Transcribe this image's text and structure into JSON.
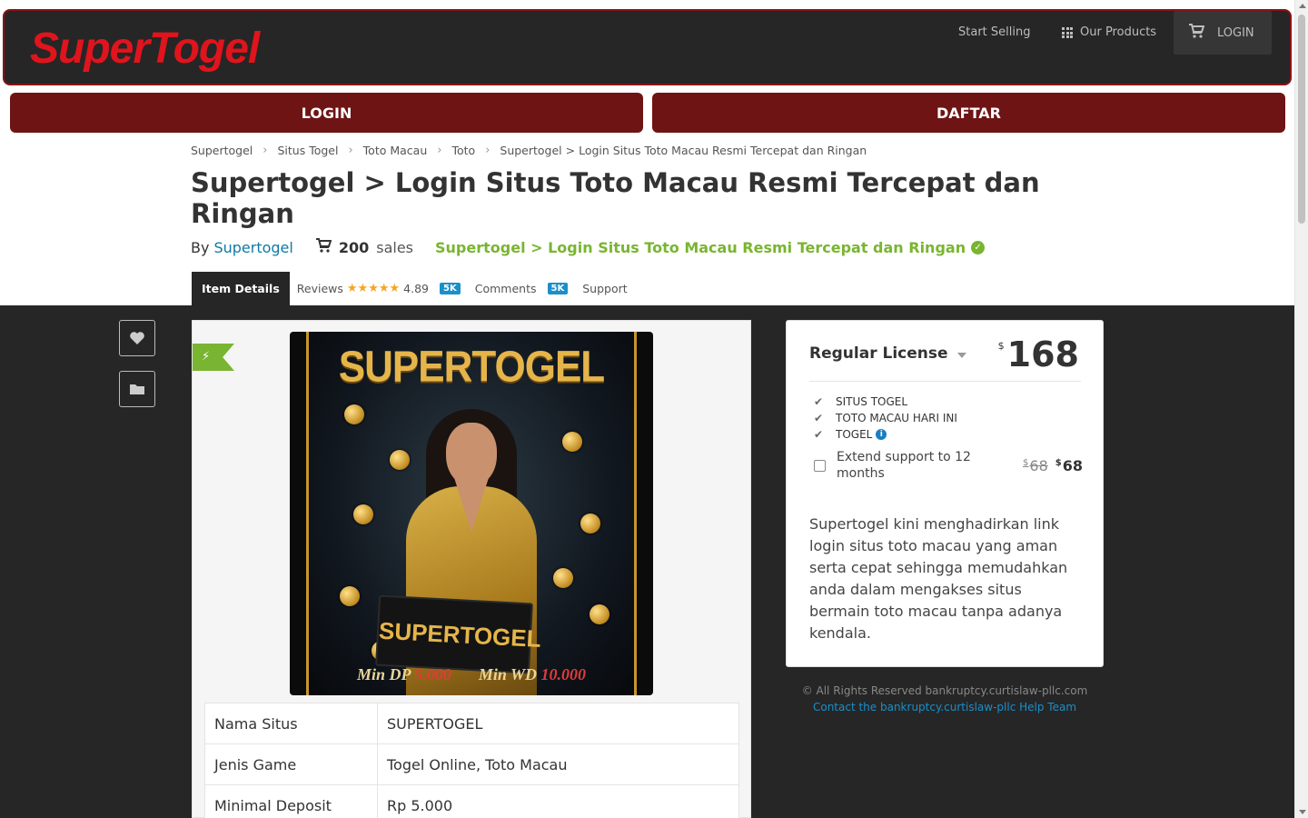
{
  "header": {
    "logo": "SuperTogel",
    "start_selling": "Start Selling",
    "our_products": "Our Products",
    "login": "LOGIN",
    "icons": {
      "products": "grid-icon",
      "login": "cart-icon"
    }
  },
  "actions": {
    "login": "LOGIN",
    "daftar": "DAFTAR"
  },
  "breadcrumb": [
    "Supertogel",
    "Situs Togel",
    "Toto Macau",
    "Toto",
    "Supertogel > Login Situs Toto Macau Resmi Tercepat dan Ringan"
  ],
  "title": "Supertogel > Login Situs Toto Macau Resmi Tercepat dan Ringan",
  "byline": {
    "by": "By",
    "author": "Supertogel",
    "sales_count": "200",
    "sales_label": "sales",
    "verified_title": "Supertogel > Login Situs Toto Macau Resmi Tercepat dan Ringan"
  },
  "tabs": {
    "item_details": "Item Details",
    "reviews": "Reviews",
    "rating": "4.89",
    "reviews_count": "5K",
    "comments": "Comments",
    "comments_count": "5K",
    "support": "Support"
  },
  "poster": {
    "title": "SUPERTOGEL",
    "sign": "SUPERTOGEL",
    "min_dp_label": "Min DP",
    "min_dp_value": "5.000",
    "min_wd_label": "Min WD",
    "min_wd_value": "10.000"
  },
  "info_table": [
    {
      "key": "Nama Situs",
      "value": "SUPERTOGEL"
    },
    {
      "key": "Jenis Game",
      "value": "Togel Online, Toto Macau"
    },
    {
      "key": "Minimal Deposit",
      "value": "Rp 5.000"
    }
  ],
  "license": {
    "name": "Regular License",
    "currency": "$",
    "price": "168",
    "features": [
      "SITUS TOGEL",
      "TOTO MACAU HARI INI",
      "TOGEL"
    ],
    "extend_label": "Extend support to 12 months",
    "extend_old_price": "68",
    "extend_new_price": "68",
    "description": "Supertogel kini menghadirkan link login situs toto macau yang aman serta cepat sehingga memudahkan anda dalam mengakses situs bermain toto macau tanpa adanya kendala."
  },
  "footer": {
    "rights": "© All Rights Reserved bankruptcy.curtislaw-pllc.com",
    "contact": "Contact the bankruptcy.curtislaw-pllc Help Team"
  },
  "colors": {
    "brand_red": "#e0141c",
    "button_maroon": "#6e1414",
    "accent_green": "#79b530",
    "link_blue": "#1a8fc9",
    "dark_bg": "#262626"
  }
}
